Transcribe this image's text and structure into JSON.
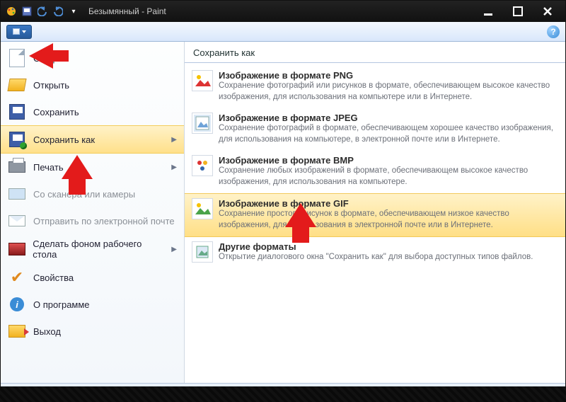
{
  "titlebar": {
    "title": "Безымянный - Paint"
  },
  "ribbon": {
    "help_tooltip": "?"
  },
  "menu": {
    "items": [
      {
        "label": "Создать"
      },
      {
        "label": "Открыть"
      },
      {
        "label": "Сохранить"
      },
      {
        "label": "Сохранить как",
        "has_sub": true,
        "selected": true
      },
      {
        "label": "Печать",
        "has_sub": true
      },
      {
        "label": "Со сканера или камеры",
        "disabled": true
      },
      {
        "label": "Отправить по электронной почте",
        "disabled": true
      },
      {
        "label": "Сделать фоном рабочего стола",
        "has_sub": true
      },
      {
        "label": "Свойства"
      },
      {
        "label": "О программе"
      },
      {
        "label": "Выход"
      }
    ]
  },
  "submenu": {
    "header": "Сохранить как",
    "formats": [
      {
        "title": "Изображение в формате PNG",
        "desc": "Сохранение фотографий или рисунков в формате, обеспечивающем высокое качество изображения, для использования на компьютере или в Интернете."
      },
      {
        "title": "Изображение в формате JPEG",
        "desc": "Сохранение фотографий в формате, обеспечивающем хорошее качество изображения, для использования на компьютере, в электронной почте или в Интернете."
      },
      {
        "title": "Изображение в формате BMP",
        "desc": "Сохранение любых изображений в формате, обеспечивающем высокое качество изображения, для использования на компьютере."
      },
      {
        "title": "Изображение в формате GIF",
        "desc": "Сохранение простого рисунок в формате, обеспечивающем низкое качество изображения, для использования в электронной почте или в Интернете.",
        "selected": true
      },
      {
        "title": "Другие форматы",
        "desc": "Открытие диалогового окна \"Сохранить как\" для выбора доступных типов файлов."
      }
    ]
  }
}
